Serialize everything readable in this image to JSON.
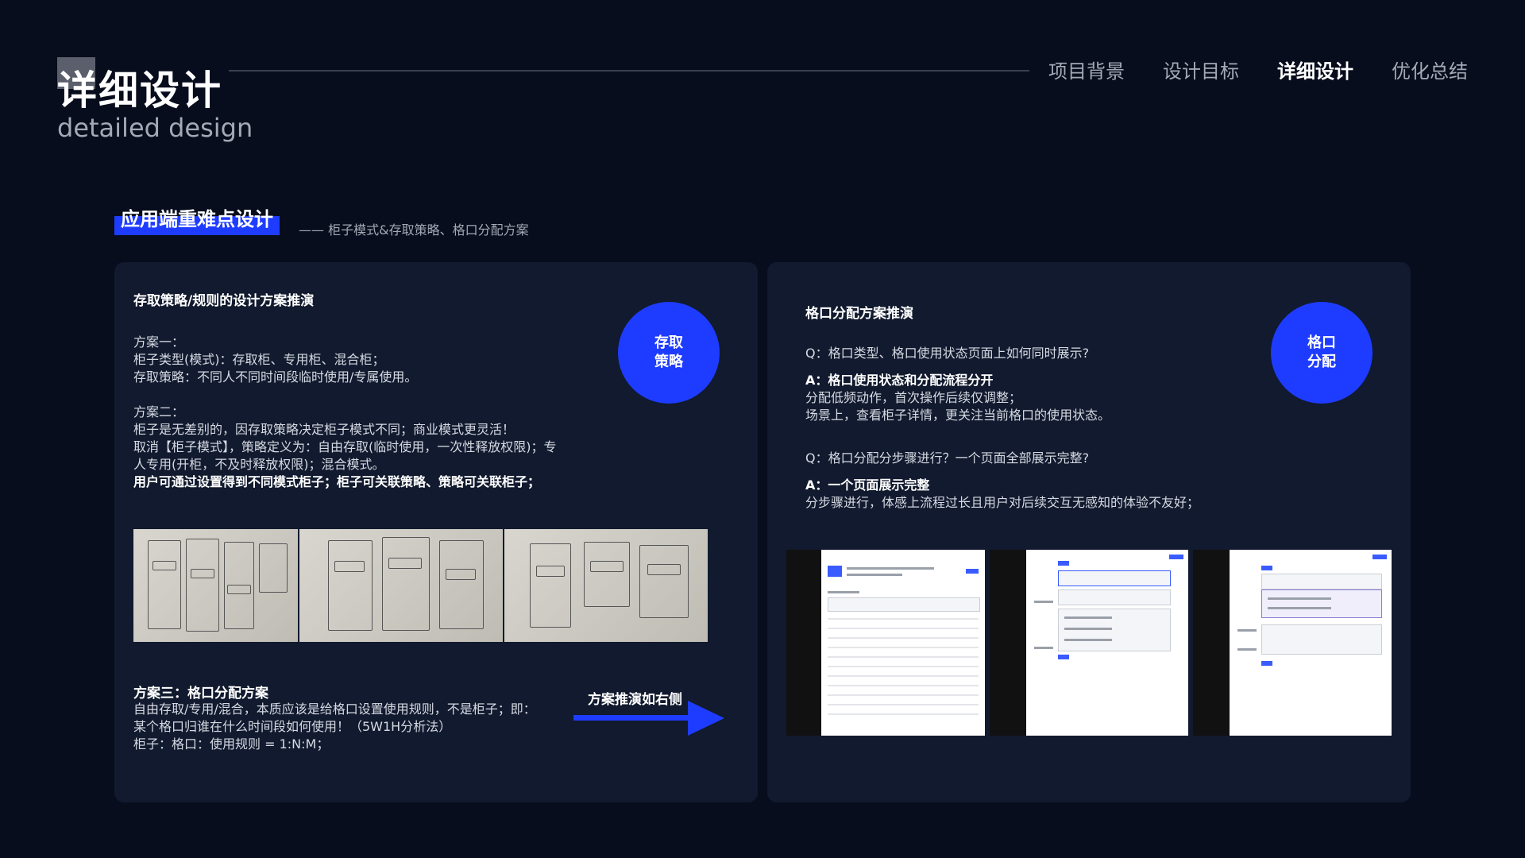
{
  "header": {
    "title": "详细设计",
    "subtitle": "detailed design",
    "nav": [
      "项目背景",
      "设计目标",
      "详细设计",
      "优化总结"
    ],
    "active_nav": 2
  },
  "section": {
    "title": "应用端重难点设计",
    "subtitle": "—— 柜子模式&存取策略、格口分配方案"
  },
  "left": {
    "heading": "存取策略/规则的设计方案推演",
    "badge": [
      "存取",
      "策略"
    ],
    "plan1": [
      "方案一：",
      "柜子类型(模式)：存取柜、专用柜、混合柜；",
      "存取策略：不同人不同时间段临时使用/专属使用。"
    ],
    "plan2": [
      "方案二：",
      "柜子是无差别的，因存取策略决定柜子模式不同；商业模式更灵活！",
      "取消【柜子模式】，策略定义为：自由存取(临时使用，一次性释放权限)；专",
      "人专用(开柜，不及时释放权限)；混合模式。"
    ],
    "plan2_bold": "用户可通过设置得到不同模式柜子；柜子可关联策略、策略可关联柜子；",
    "plan3_title": "方案三：格口分配方案",
    "plan3": [
      "自由存取/专用/混合，本质应该是给格口设置使用规则，不是柜子；即：",
      "某个格口归谁在什么时间段如何使用！（5W1H分析法）",
      "柜子：格口：使用规则 = 1:N:M；"
    ],
    "arrow_label": "方案推演如右侧"
  },
  "right": {
    "heading": "格口分配方案推演",
    "badge": [
      "格口",
      "分配"
    ],
    "q1": "Q：格口类型、格口使用状态页面上如何同时展示?",
    "a1_bold": "A：格口使用状态和分配流程分开",
    "a1": [
      "分配低频动作，首次操作后续仅调整；",
      "场景上，查看柜子详情，更关注当前格口的使用状态。"
    ],
    "q2": "Q：格口分配分步骤进行？一个页面全部展示完整?",
    "a2_bold": "A：一个页面展示完整",
    "a2": [
      "分步骤进行，体感上流程过长且用户对后续交互无感知的体验不友好；"
    ]
  },
  "colors": {
    "accent": "#1e3cff",
    "background": "#070d1d",
    "panel": "#111a2e"
  }
}
